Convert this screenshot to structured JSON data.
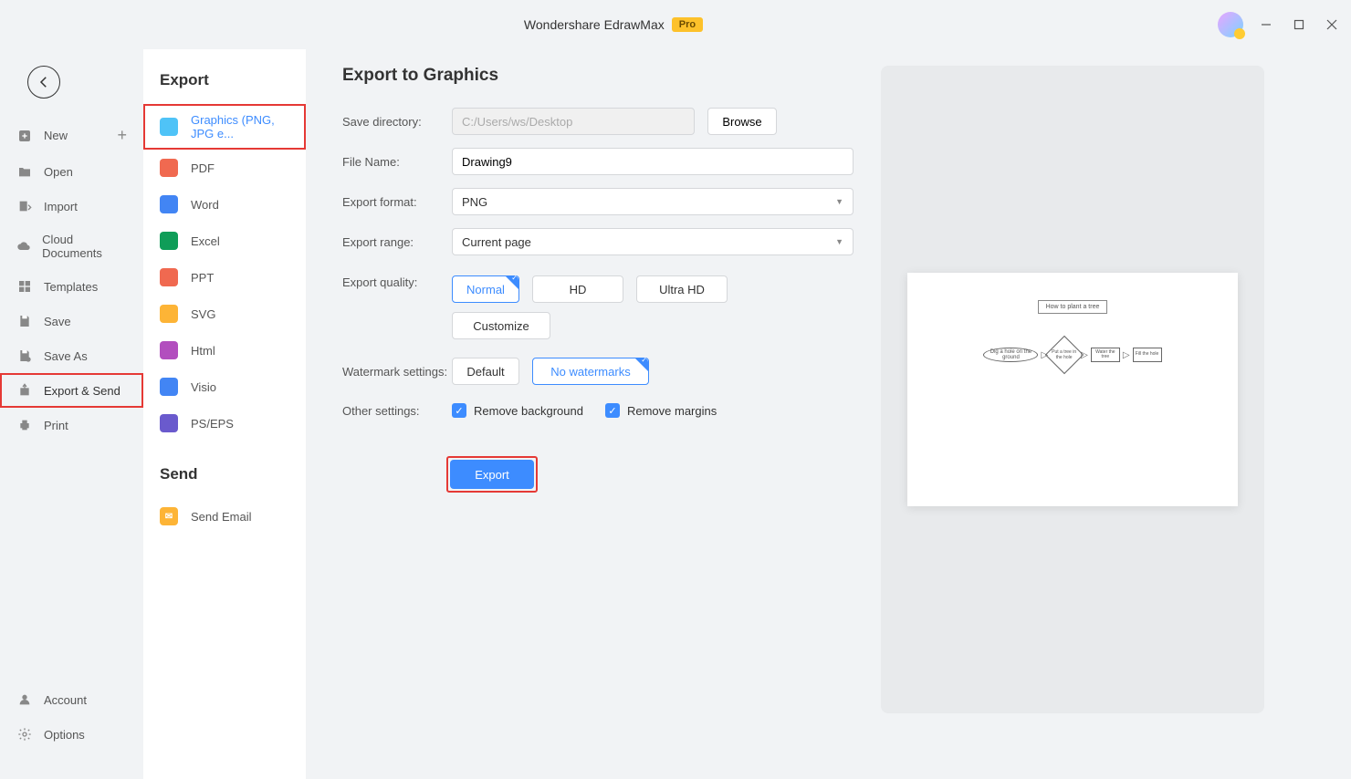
{
  "titlebar": {
    "app_name": "Wondershare EdrawMax",
    "badge": "Pro"
  },
  "sidebar1": {
    "items": [
      {
        "label": "New",
        "icon": "plus-square",
        "hasPlus": true
      },
      {
        "label": "Open",
        "icon": "folder"
      },
      {
        "label": "Import",
        "icon": "import"
      },
      {
        "label": "Cloud Documents",
        "icon": "cloud"
      },
      {
        "label": "Templates",
        "icon": "templates"
      },
      {
        "label": "Save",
        "icon": "save"
      },
      {
        "label": "Save As",
        "icon": "saveas"
      },
      {
        "label": "Export & Send",
        "icon": "export",
        "highlighted": true
      },
      {
        "label": "Print",
        "icon": "print"
      }
    ],
    "bottom": [
      {
        "label": "Account",
        "icon": "account"
      },
      {
        "label": "Options",
        "icon": "gear"
      }
    ]
  },
  "sidebar2": {
    "export_heading": "Export",
    "send_heading": "Send",
    "formats": [
      {
        "label": "Graphics (PNG, JPG e...",
        "selected": true,
        "highlighted": true,
        "cls": "fmt-img"
      },
      {
        "label": "PDF",
        "cls": "fmt-pdf"
      },
      {
        "label": "Word",
        "cls": "fmt-word"
      },
      {
        "label": "Excel",
        "cls": "fmt-excel"
      },
      {
        "label": "PPT",
        "cls": "fmt-ppt"
      },
      {
        "label": "SVG",
        "cls": "fmt-svg"
      },
      {
        "label": "Html",
        "cls": "fmt-html"
      },
      {
        "label": "Visio",
        "cls": "fmt-visio"
      },
      {
        "label": "PS/EPS",
        "cls": "fmt-ps"
      }
    ],
    "send": [
      {
        "label": "Send Email",
        "cls": "fmt-email"
      }
    ]
  },
  "form": {
    "title": "Export to Graphics",
    "save_dir_label": "Save directory:",
    "save_dir_value": "C:/Users/ws/Desktop",
    "browse": "Browse",
    "filename_label": "File Name:",
    "filename_value": "Drawing9",
    "format_label": "Export format:",
    "format_value": "PNG",
    "range_label": "Export range:",
    "range_value": "Current page",
    "quality_label": "Export quality:",
    "quality_options": {
      "normal": "Normal",
      "hd": "HD",
      "uhd": "Ultra HD",
      "custom": "Customize"
    },
    "watermark_label": "Watermark settings:",
    "watermark_options": {
      "default": "Default",
      "none": "No watermarks"
    },
    "other_label": "Other settings:",
    "check1": "Remove background",
    "check2": "Remove margins",
    "export_btn": "Export"
  },
  "preview": {
    "title": "How to plant a tree",
    "step1": "Dig a hole on the ground",
    "step2": "Put a tree in the hole",
    "step3": "Water the tree",
    "step4": "Fill the hole"
  }
}
